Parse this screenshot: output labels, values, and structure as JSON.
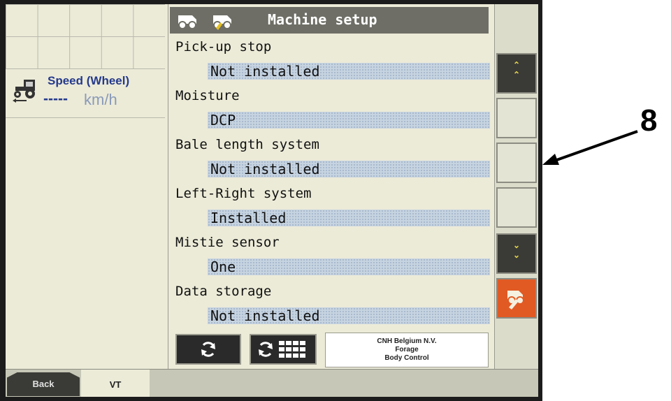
{
  "title": "Machine setup",
  "speed": {
    "label": "Speed (Wheel)",
    "value": "-----",
    "unit": "km/h"
  },
  "settings": [
    {
      "label": "Pick-up stop",
      "value": "Not installed"
    },
    {
      "label": "Moisture",
      "value": "DCP"
    },
    {
      "label": "Bale length system",
      "value": "Not installed"
    },
    {
      "label": "Left-Right system",
      "value": "Installed"
    },
    {
      "label": "Mistie sensor",
      "value": "One"
    },
    {
      "label": "Data storage",
      "value": "Not installed"
    }
  ],
  "cnh": {
    "line1": "CNH Belgium N.V.",
    "line2": "Forage",
    "line3": "Body Control"
  },
  "tabs": {
    "back": "Back",
    "vt": "VT"
  },
  "softkeys": {
    "scroll_up": "chevron-double-up-icon",
    "scroll_down": "chevron-double-down-icon",
    "baler": "baler-wrench-icon"
  },
  "annotation": {
    "number": "8"
  },
  "colors": {
    "value_bg": "#c6d3e0",
    "title_bg": "#6e6e66",
    "accent_orange": "#e15a24",
    "speed_text": "#253a8c"
  }
}
